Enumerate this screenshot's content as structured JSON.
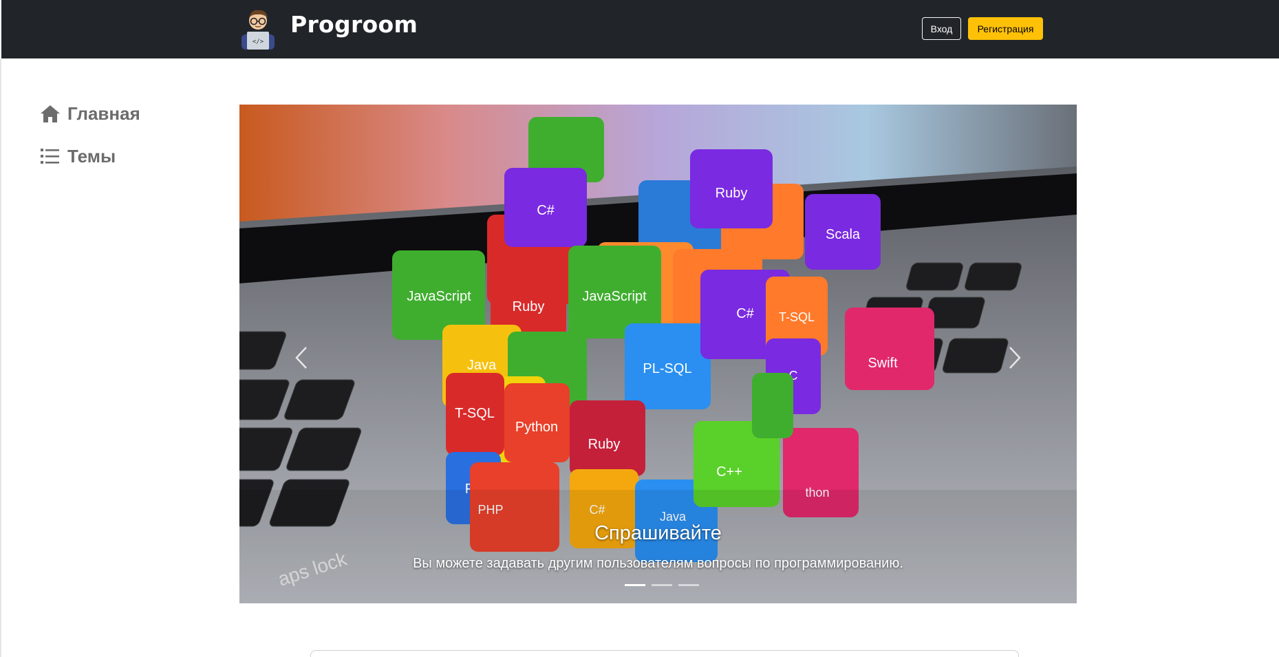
{
  "header": {
    "brand": "Progroom",
    "logo_icon": "programmer-avatar-icon",
    "login_label": "Вход",
    "register_label": "Регистрация"
  },
  "sidebar": {
    "items": [
      {
        "label": "Главная",
        "icon": "home-icon"
      },
      {
        "label": "Темы",
        "icon": "list-icon"
      }
    ]
  },
  "carousel": {
    "slide_title": "Спрашивайте",
    "slide_text": "Вы можете задавать другим пользователям вопросы по программированию.",
    "cube_labels": [
      "JavaScript",
      "C#",
      "Ruby",
      "Java",
      "PL-SQL",
      "T-SQL",
      "Python",
      "PHP",
      "C++",
      "Swift",
      "Scala",
      "C"
    ],
    "slides_count": 3,
    "active_slide": 1
  },
  "colors": {
    "header_bg": "#212529",
    "accent": "#ffc107",
    "sidebar_text": "#6c6c6c"
  }
}
